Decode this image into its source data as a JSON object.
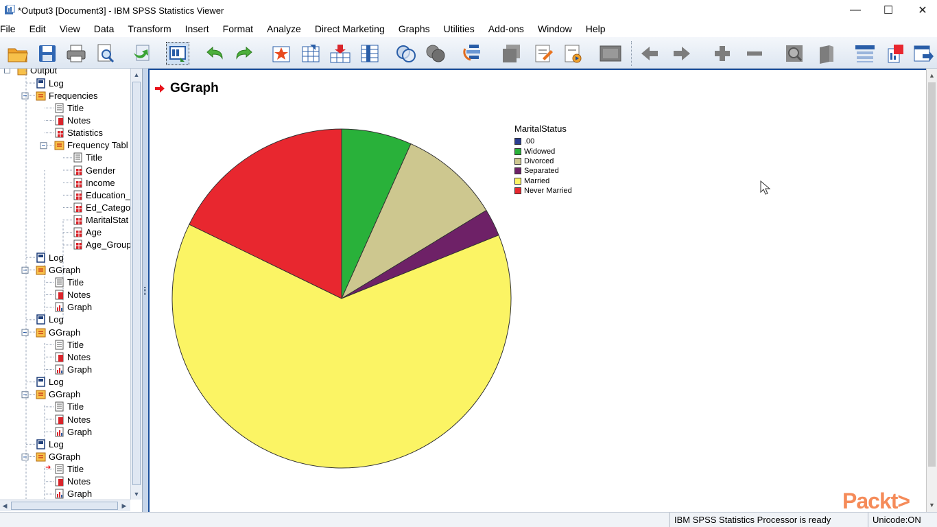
{
  "window": {
    "title": "*Output3 [Document3] - IBM SPSS Statistics Viewer",
    "controls": {
      "minimize": "—",
      "maximize": "☐",
      "close": "✕"
    }
  },
  "menu": [
    "File",
    "Edit",
    "View",
    "Data",
    "Transform",
    "Insert",
    "Format",
    "Analyze",
    "Direct Marketing",
    "Graphs",
    "Utilities",
    "Add-ons",
    "Window",
    "Help"
  ],
  "toolbar": {
    "icons": [
      "open-folder-icon",
      "save-icon",
      "print-icon",
      "print-preview-icon",
      "export-icon",
      "recall-dialog-icon",
      "undo-icon",
      "redo-icon",
      "goto-case-icon",
      "goto-variable-icon",
      "insert-cases-icon",
      "variables-icon",
      "select-cases-icon",
      "weight-cases-icon",
      "split-file-icon",
      "designate-window-icon",
      "insert-title-icon",
      "insert-text-icon",
      "insert-page-break-icon",
      "select-last-output-icon",
      "promote-icon",
      "demote-icon",
      "expand-icon",
      "collapse-icon",
      "show-icon",
      "hide-icon",
      "insert-heading-icon",
      "insert-new-text-icon",
      "export-output-icon"
    ]
  },
  "outline": {
    "root": "Output",
    "items": [
      {
        "label": "Log",
        "level": 1,
        "kind": "log"
      },
      {
        "label": "Frequencies",
        "level": 1,
        "kind": "folder"
      },
      {
        "label": "Title",
        "level": 2,
        "kind": "title"
      },
      {
        "label": "Notes",
        "level": 2,
        "kind": "notes"
      },
      {
        "label": "Statistics",
        "level": 2,
        "kind": "table"
      },
      {
        "label": "Frequency Tabl",
        "level": 2,
        "kind": "folder"
      },
      {
        "label": "Title",
        "level": 3,
        "kind": "title"
      },
      {
        "label": "Gender",
        "level": 3,
        "kind": "table"
      },
      {
        "label": "Income",
        "level": 3,
        "kind": "table"
      },
      {
        "label": "Education_",
        "level": 3,
        "kind": "table"
      },
      {
        "label": "Ed_Catego",
        "level": 3,
        "kind": "table"
      },
      {
        "label": "MaritalStat",
        "level": 3,
        "kind": "table"
      },
      {
        "label": "Age",
        "level": 3,
        "kind": "table"
      },
      {
        "label": "Age_Group",
        "level": 3,
        "kind": "table"
      },
      {
        "label": "Log",
        "level": 1,
        "kind": "log"
      },
      {
        "label": "GGraph",
        "level": 1,
        "kind": "folder"
      },
      {
        "label": "Title",
        "level": 2,
        "kind": "title"
      },
      {
        "label": "Notes",
        "level": 2,
        "kind": "notes"
      },
      {
        "label": "Graph",
        "level": 2,
        "kind": "graph"
      },
      {
        "label": "Log",
        "level": 1,
        "kind": "log"
      },
      {
        "label": "GGraph",
        "level": 1,
        "kind": "folder"
      },
      {
        "label": "Title",
        "level": 2,
        "kind": "title"
      },
      {
        "label": "Notes",
        "level": 2,
        "kind": "notes"
      },
      {
        "label": "Graph",
        "level": 2,
        "kind": "graph"
      },
      {
        "label": "Log",
        "level": 1,
        "kind": "log"
      },
      {
        "label": "GGraph",
        "level": 1,
        "kind": "folder"
      },
      {
        "label": "Title",
        "level": 2,
        "kind": "title"
      },
      {
        "label": "Notes",
        "level": 2,
        "kind": "notes"
      },
      {
        "label": "Graph",
        "level": 2,
        "kind": "graph"
      },
      {
        "label": "Log",
        "level": 1,
        "kind": "log"
      },
      {
        "label": "GGraph",
        "level": 1,
        "kind": "folder"
      },
      {
        "label": "Title",
        "level": 2,
        "kind": "title",
        "current": true
      },
      {
        "label": "Notes",
        "level": 2,
        "kind": "notes"
      },
      {
        "label": "Graph",
        "level": 2,
        "kind": "graph"
      }
    ]
  },
  "output": {
    "heading": "GGraph"
  },
  "chart_data": {
    "type": "pie",
    "legend_title": "MaritalStatus",
    "legend_position": "top-right",
    "categories": [
      ".00",
      "Widowed",
      "Divorced",
      "Separated",
      "Married",
      "Never Married"
    ],
    "values": [
      0.0,
      6.7,
      9.6,
      2.6,
      63.3,
      17.8
    ],
    "colors": [
      "#2a3d8f",
      "#29b13a",
      "#cdc78f",
      "#6e2167",
      "#fbf464",
      "#e8272f"
    ]
  },
  "status": {
    "processor": "IBM SPSS Statistics Processor is ready",
    "unicode": "Unicode:ON"
  },
  "watermark": "Packt>"
}
